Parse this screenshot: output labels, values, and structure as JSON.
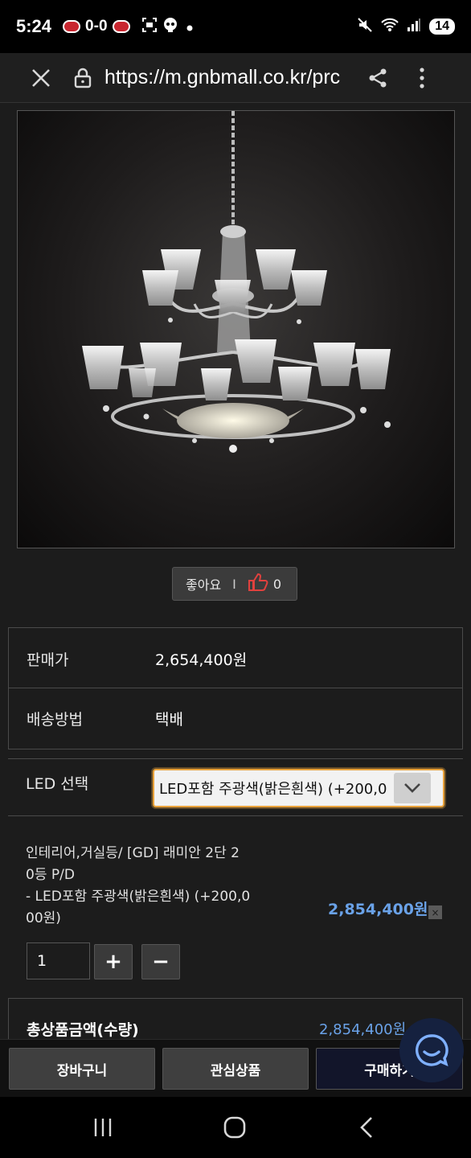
{
  "status_bar": {
    "time": "5:24",
    "score": "0-0",
    "battery": "14",
    "icons": [
      "screenshot-icon",
      "skull-icon",
      "dot-icon",
      "mute-icon",
      "wifi-icon",
      "signal-icon"
    ]
  },
  "browser": {
    "url": "https://m.gnbmall.co.kr/prc",
    "icons": [
      "close-icon",
      "lock-icon",
      "share-icon",
      "more-icon"
    ]
  },
  "product": {
    "image_alt": "chandelier",
    "like_label": "좋아요",
    "like_separator": "I",
    "like_count": "0"
  },
  "info": {
    "price_label": "판매가",
    "price_value": "2,654,400원",
    "shipping_label": "배송방법",
    "shipping_value": "택배"
  },
  "option": {
    "label": "LED 선택",
    "selected": "LED포함 주광색(밝은흰색) (+200,0"
  },
  "selected_item": {
    "name_line1": "인테리어,거실등/ [GD] 래미안 2단 2",
    "name_line2": "0등 P/D",
    "option_line1": "- LED포함 주광색(밝은흰색) (+200,0",
    "option_line2": "00원)",
    "price": "2,854,400원",
    "remove": "×",
    "quantity": "1",
    "plus": "+",
    "minus": "−"
  },
  "total": {
    "label": "총상품금액(수량)",
    "value": "2,854,400원"
  },
  "actions": {
    "cart": "장바구니",
    "wishlist": "관심상품",
    "buy": "구매하기"
  },
  "colors": {
    "price_blue": "#6aa2e8",
    "select_focus": "#e9a23b",
    "buy_bg": "#12152a"
  }
}
